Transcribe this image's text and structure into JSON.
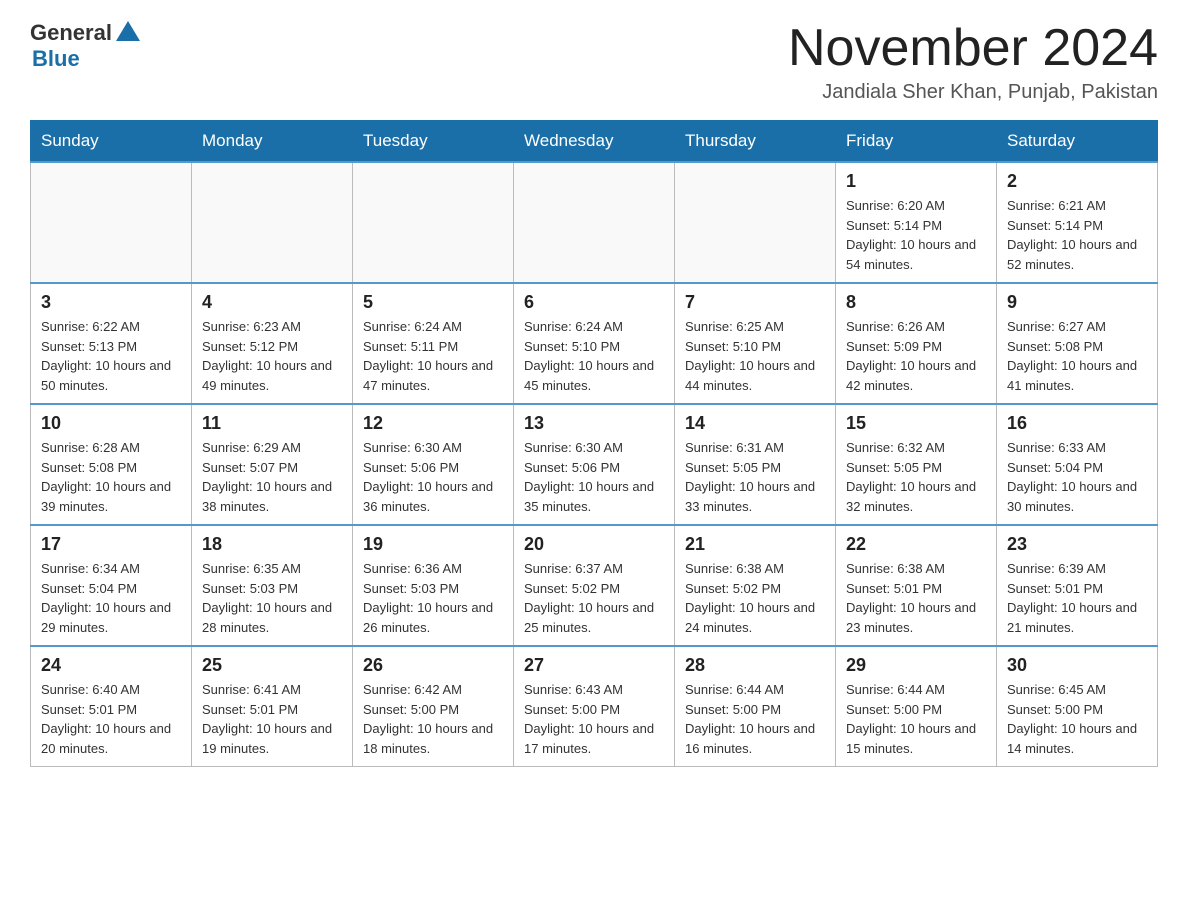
{
  "header": {
    "logo_general": "General",
    "logo_blue": "Blue",
    "month_title": "November 2024",
    "location": "Jandiala Sher Khan, Punjab, Pakistan"
  },
  "days_of_week": [
    "Sunday",
    "Monday",
    "Tuesday",
    "Wednesday",
    "Thursday",
    "Friday",
    "Saturday"
  ],
  "weeks": [
    [
      {
        "day": "",
        "sunrise": "",
        "sunset": "",
        "daylight": ""
      },
      {
        "day": "",
        "sunrise": "",
        "sunset": "",
        "daylight": ""
      },
      {
        "day": "",
        "sunrise": "",
        "sunset": "",
        "daylight": ""
      },
      {
        "day": "",
        "sunrise": "",
        "sunset": "",
        "daylight": ""
      },
      {
        "day": "",
        "sunrise": "",
        "sunset": "",
        "daylight": ""
      },
      {
        "day": "1",
        "sunrise": "Sunrise: 6:20 AM",
        "sunset": "Sunset: 5:14 PM",
        "daylight": "Daylight: 10 hours and 54 minutes."
      },
      {
        "day": "2",
        "sunrise": "Sunrise: 6:21 AM",
        "sunset": "Sunset: 5:14 PM",
        "daylight": "Daylight: 10 hours and 52 minutes."
      }
    ],
    [
      {
        "day": "3",
        "sunrise": "Sunrise: 6:22 AM",
        "sunset": "Sunset: 5:13 PM",
        "daylight": "Daylight: 10 hours and 50 minutes."
      },
      {
        "day": "4",
        "sunrise": "Sunrise: 6:23 AM",
        "sunset": "Sunset: 5:12 PM",
        "daylight": "Daylight: 10 hours and 49 minutes."
      },
      {
        "day": "5",
        "sunrise": "Sunrise: 6:24 AM",
        "sunset": "Sunset: 5:11 PM",
        "daylight": "Daylight: 10 hours and 47 minutes."
      },
      {
        "day": "6",
        "sunrise": "Sunrise: 6:24 AM",
        "sunset": "Sunset: 5:10 PM",
        "daylight": "Daylight: 10 hours and 45 minutes."
      },
      {
        "day": "7",
        "sunrise": "Sunrise: 6:25 AM",
        "sunset": "Sunset: 5:10 PM",
        "daylight": "Daylight: 10 hours and 44 minutes."
      },
      {
        "day": "8",
        "sunrise": "Sunrise: 6:26 AM",
        "sunset": "Sunset: 5:09 PM",
        "daylight": "Daylight: 10 hours and 42 minutes."
      },
      {
        "day": "9",
        "sunrise": "Sunrise: 6:27 AM",
        "sunset": "Sunset: 5:08 PM",
        "daylight": "Daylight: 10 hours and 41 minutes."
      }
    ],
    [
      {
        "day": "10",
        "sunrise": "Sunrise: 6:28 AM",
        "sunset": "Sunset: 5:08 PM",
        "daylight": "Daylight: 10 hours and 39 minutes."
      },
      {
        "day": "11",
        "sunrise": "Sunrise: 6:29 AM",
        "sunset": "Sunset: 5:07 PM",
        "daylight": "Daylight: 10 hours and 38 minutes."
      },
      {
        "day": "12",
        "sunrise": "Sunrise: 6:30 AM",
        "sunset": "Sunset: 5:06 PM",
        "daylight": "Daylight: 10 hours and 36 minutes."
      },
      {
        "day": "13",
        "sunrise": "Sunrise: 6:30 AM",
        "sunset": "Sunset: 5:06 PM",
        "daylight": "Daylight: 10 hours and 35 minutes."
      },
      {
        "day": "14",
        "sunrise": "Sunrise: 6:31 AM",
        "sunset": "Sunset: 5:05 PM",
        "daylight": "Daylight: 10 hours and 33 minutes."
      },
      {
        "day": "15",
        "sunrise": "Sunrise: 6:32 AM",
        "sunset": "Sunset: 5:05 PM",
        "daylight": "Daylight: 10 hours and 32 minutes."
      },
      {
        "day": "16",
        "sunrise": "Sunrise: 6:33 AM",
        "sunset": "Sunset: 5:04 PM",
        "daylight": "Daylight: 10 hours and 30 minutes."
      }
    ],
    [
      {
        "day": "17",
        "sunrise": "Sunrise: 6:34 AM",
        "sunset": "Sunset: 5:04 PM",
        "daylight": "Daylight: 10 hours and 29 minutes."
      },
      {
        "day": "18",
        "sunrise": "Sunrise: 6:35 AM",
        "sunset": "Sunset: 5:03 PM",
        "daylight": "Daylight: 10 hours and 28 minutes."
      },
      {
        "day": "19",
        "sunrise": "Sunrise: 6:36 AM",
        "sunset": "Sunset: 5:03 PM",
        "daylight": "Daylight: 10 hours and 26 minutes."
      },
      {
        "day": "20",
        "sunrise": "Sunrise: 6:37 AM",
        "sunset": "Sunset: 5:02 PM",
        "daylight": "Daylight: 10 hours and 25 minutes."
      },
      {
        "day": "21",
        "sunrise": "Sunrise: 6:38 AM",
        "sunset": "Sunset: 5:02 PM",
        "daylight": "Daylight: 10 hours and 24 minutes."
      },
      {
        "day": "22",
        "sunrise": "Sunrise: 6:38 AM",
        "sunset": "Sunset: 5:01 PM",
        "daylight": "Daylight: 10 hours and 23 minutes."
      },
      {
        "day": "23",
        "sunrise": "Sunrise: 6:39 AM",
        "sunset": "Sunset: 5:01 PM",
        "daylight": "Daylight: 10 hours and 21 minutes."
      }
    ],
    [
      {
        "day": "24",
        "sunrise": "Sunrise: 6:40 AM",
        "sunset": "Sunset: 5:01 PM",
        "daylight": "Daylight: 10 hours and 20 minutes."
      },
      {
        "day": "25",
        "sunrise": "Sunrise: 6:41 AM",
        "sunset": "Sunset: 5:01 PM",
        "daylight": "Daylight: 10 hours and 19 minutes."
      },
      {
        "day": "26",
        "sunrise": "Sunrise: 6:42 AM",
        "sunset": "Sunset: 5:00 PM",
        "daylight": "Daylight: 10 hours and 18 minutes."
      },
      {
        "day": "27",
        "sunrise": "Sunrise: 6:43 AM",
        "sunset": "Sunset: 5:00 PM",
        "daylight": "Daylight: 10 hours and 17 minutes."
      },
      {
        "day": "28",
        "sunrise": "Sunrise: 6:44 AM",
        "sunset": "Sunset: 5:00 PM",
        "daylight": "Daylight: 10 hours and 16 minutes."
      },
      {
        "day": "29",
        "sunrise": "Sunrise: 6:44 AM",
        "sunset": "Sunset: 5:00 PM",
        "daylight": "Daylight: 10 hours and 15 minutes."
      },
      {
        "day": "30",
        "sunrise": "Sunrise: 6:45 AM",
        "sunset": "Sunset: 5:00 PM",
        "daylight": "Daylight: 10 hours and 14 minutes."
      }
    ]
  ]
}
